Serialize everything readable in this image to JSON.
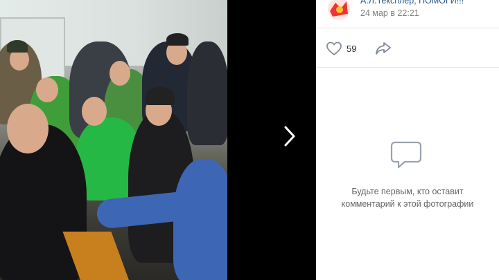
{
  "post": {
    "author": "А.Л.Тексплер, ПОМОГИ!!!",
    "date": "24 мар в 22:21"
  },
  "actions": {
    "likes": "59",
    "like_icon": "heart-icon",
    "share_icon": "share-arrow-icon"
  },
  "comments": {
    "empty_icon": "comment-bubbles-icon",
    "empty_line1": "Будьте первым, кто оставит",
    "empty_line2": "комментарий к этой фотографии"
  },
  "viewer": {
    "next_icon": "chevron-right-icon"
  },
  "colors": {
    "link": "#2a5885",
    "muted": "#828282",
    "icon": "#99a2ad",
    "background": "#000000"
  }
}
